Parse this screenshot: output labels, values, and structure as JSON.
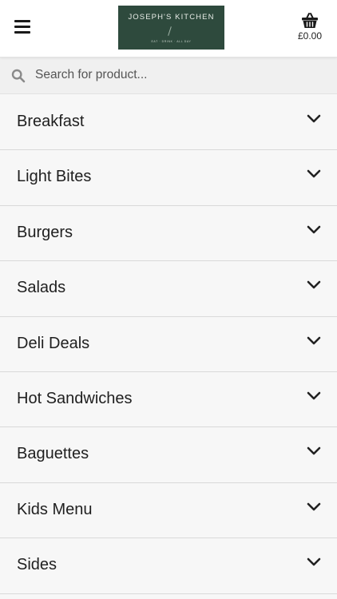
{
  "header": {
    "menu_icon": "hamburger-menu-icon",
    "logo": {
      "name": "JOSEPH'S KITCHEN",
      "tagline": "EAT · DRINK · ALL DAY",
      "background": "#2e4a3d"
    },
    "cart": {
      "icon": "basket-icon",
      "total": "£0.00"
    }
  },
  "search": {
    "icon": "search-icon",
    "placeholder": "Search for product...",
    "value": ""
  },
  "categories": [
    {
      "label": "Breakfast"
    },
    {
      "label": "Light Bites"
    },
    {
      "label": "Burgers"
    },
    {
      "label": "Salads"
    },
    {
      "label": "Deli Deals"
    },
    {
      "label": "Hot Sandwiches"
    },
    {
      "label": "Baguettes"
    },
    {
      "label": "Kids Menu"
    },
    {
      "label": "Sides"
    }
  ],
  "category_icon": "chevron-down-icon"
}
